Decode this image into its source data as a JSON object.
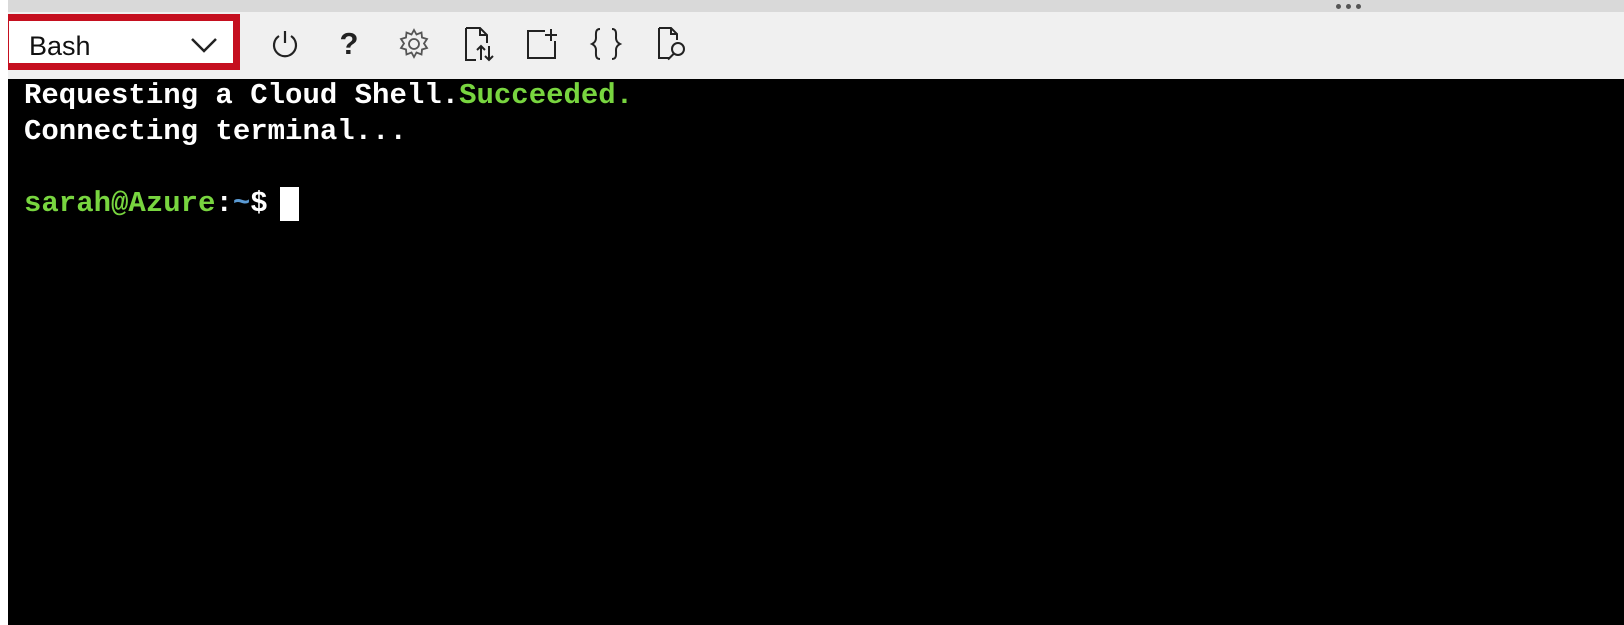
{
  "toolbar": {
    "shell_selector": {
      "value": "Bash",
      "highlight_color": "#c50f1f"
    },
    "icons": [
      "power-icon",
      "help-icon",
      "gear-icon",
      "upload-download-icon",
      "new-session-icon",
      "braces-icon",
      "preview-icon"
    ],
    "help_glyph": "?"
  },
  "terminal": {
    "line1": {
      "text": "Requesting a Cloud Shell.",
      "status": "Succeeded."
    },
    "line2": {
      "text": "Connecting terminal..."
    },
    "prompt": {
      "user_host": "sarah@Azure",
      "separator": ":",
      "path": "~",
      "symbol": "$"
    },
    "colors": {
      "background": "#000000",
      "text": "#ffffff",
      "success": "#78d53f",
      "path": "#5b9bd5"
    }
  }
}
